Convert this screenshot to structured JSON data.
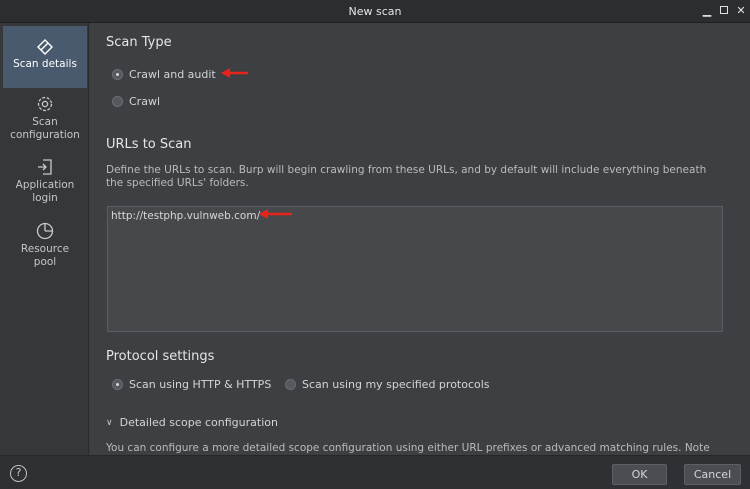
{
  "window": {
    "title": "New scan"
  },
  "sidebar": {
    "items": [
      {
        "label": "Scan details",
        "icon": "scan-details-icon"
      },
      {
        "label": "Scan configuration",
        "icon": "gear-icon"
      },
      {
        "label": "Application login",
        "icon": "login-icon"
      },
      {
        "label": "Resource pool",
        "icon": "pie-chart-icon"
      }
    ]
  },
  "scan_type": {
    "title": "Scan Type",
    "options": [
      {
        "label": "Crawl and audit",
        "checked": true
      },
      {
        "label": "Crawl",
        "checked": false
      }
    ]
  },
  "urls": {
    "title": "URLs to Scan",
    "description": "Define the URLs to scan. Burp will begin crawling from these URLs, and by default will include everything beneath the specified URLs' folders.",
    "value": "http://testphp.vulnweb.com/"
  },
  "protocol": {
    "title": "Protocol settings",
    "options": [
      {
        "label": "Scan using HTTP & HTTPS",
        "checked": true
      },
      {
        "label": "Scan using my specified protocols",
        "checked": false
      }
    ]
  },
  "scope": {
    "label": "Detailed scope configuration",
    "description": "You can configure a more detailed scope configuration using either URL prefixes or advanced matching rules. Note"
  },
  "footer": {
    "help": "?",
    "ok": "OK",
    "cancel": "Cancel"
  },
  "colors": {
    "accent_arrow": "#e8231a",
    "active_nav": "#4a5a6e"
  }
}
